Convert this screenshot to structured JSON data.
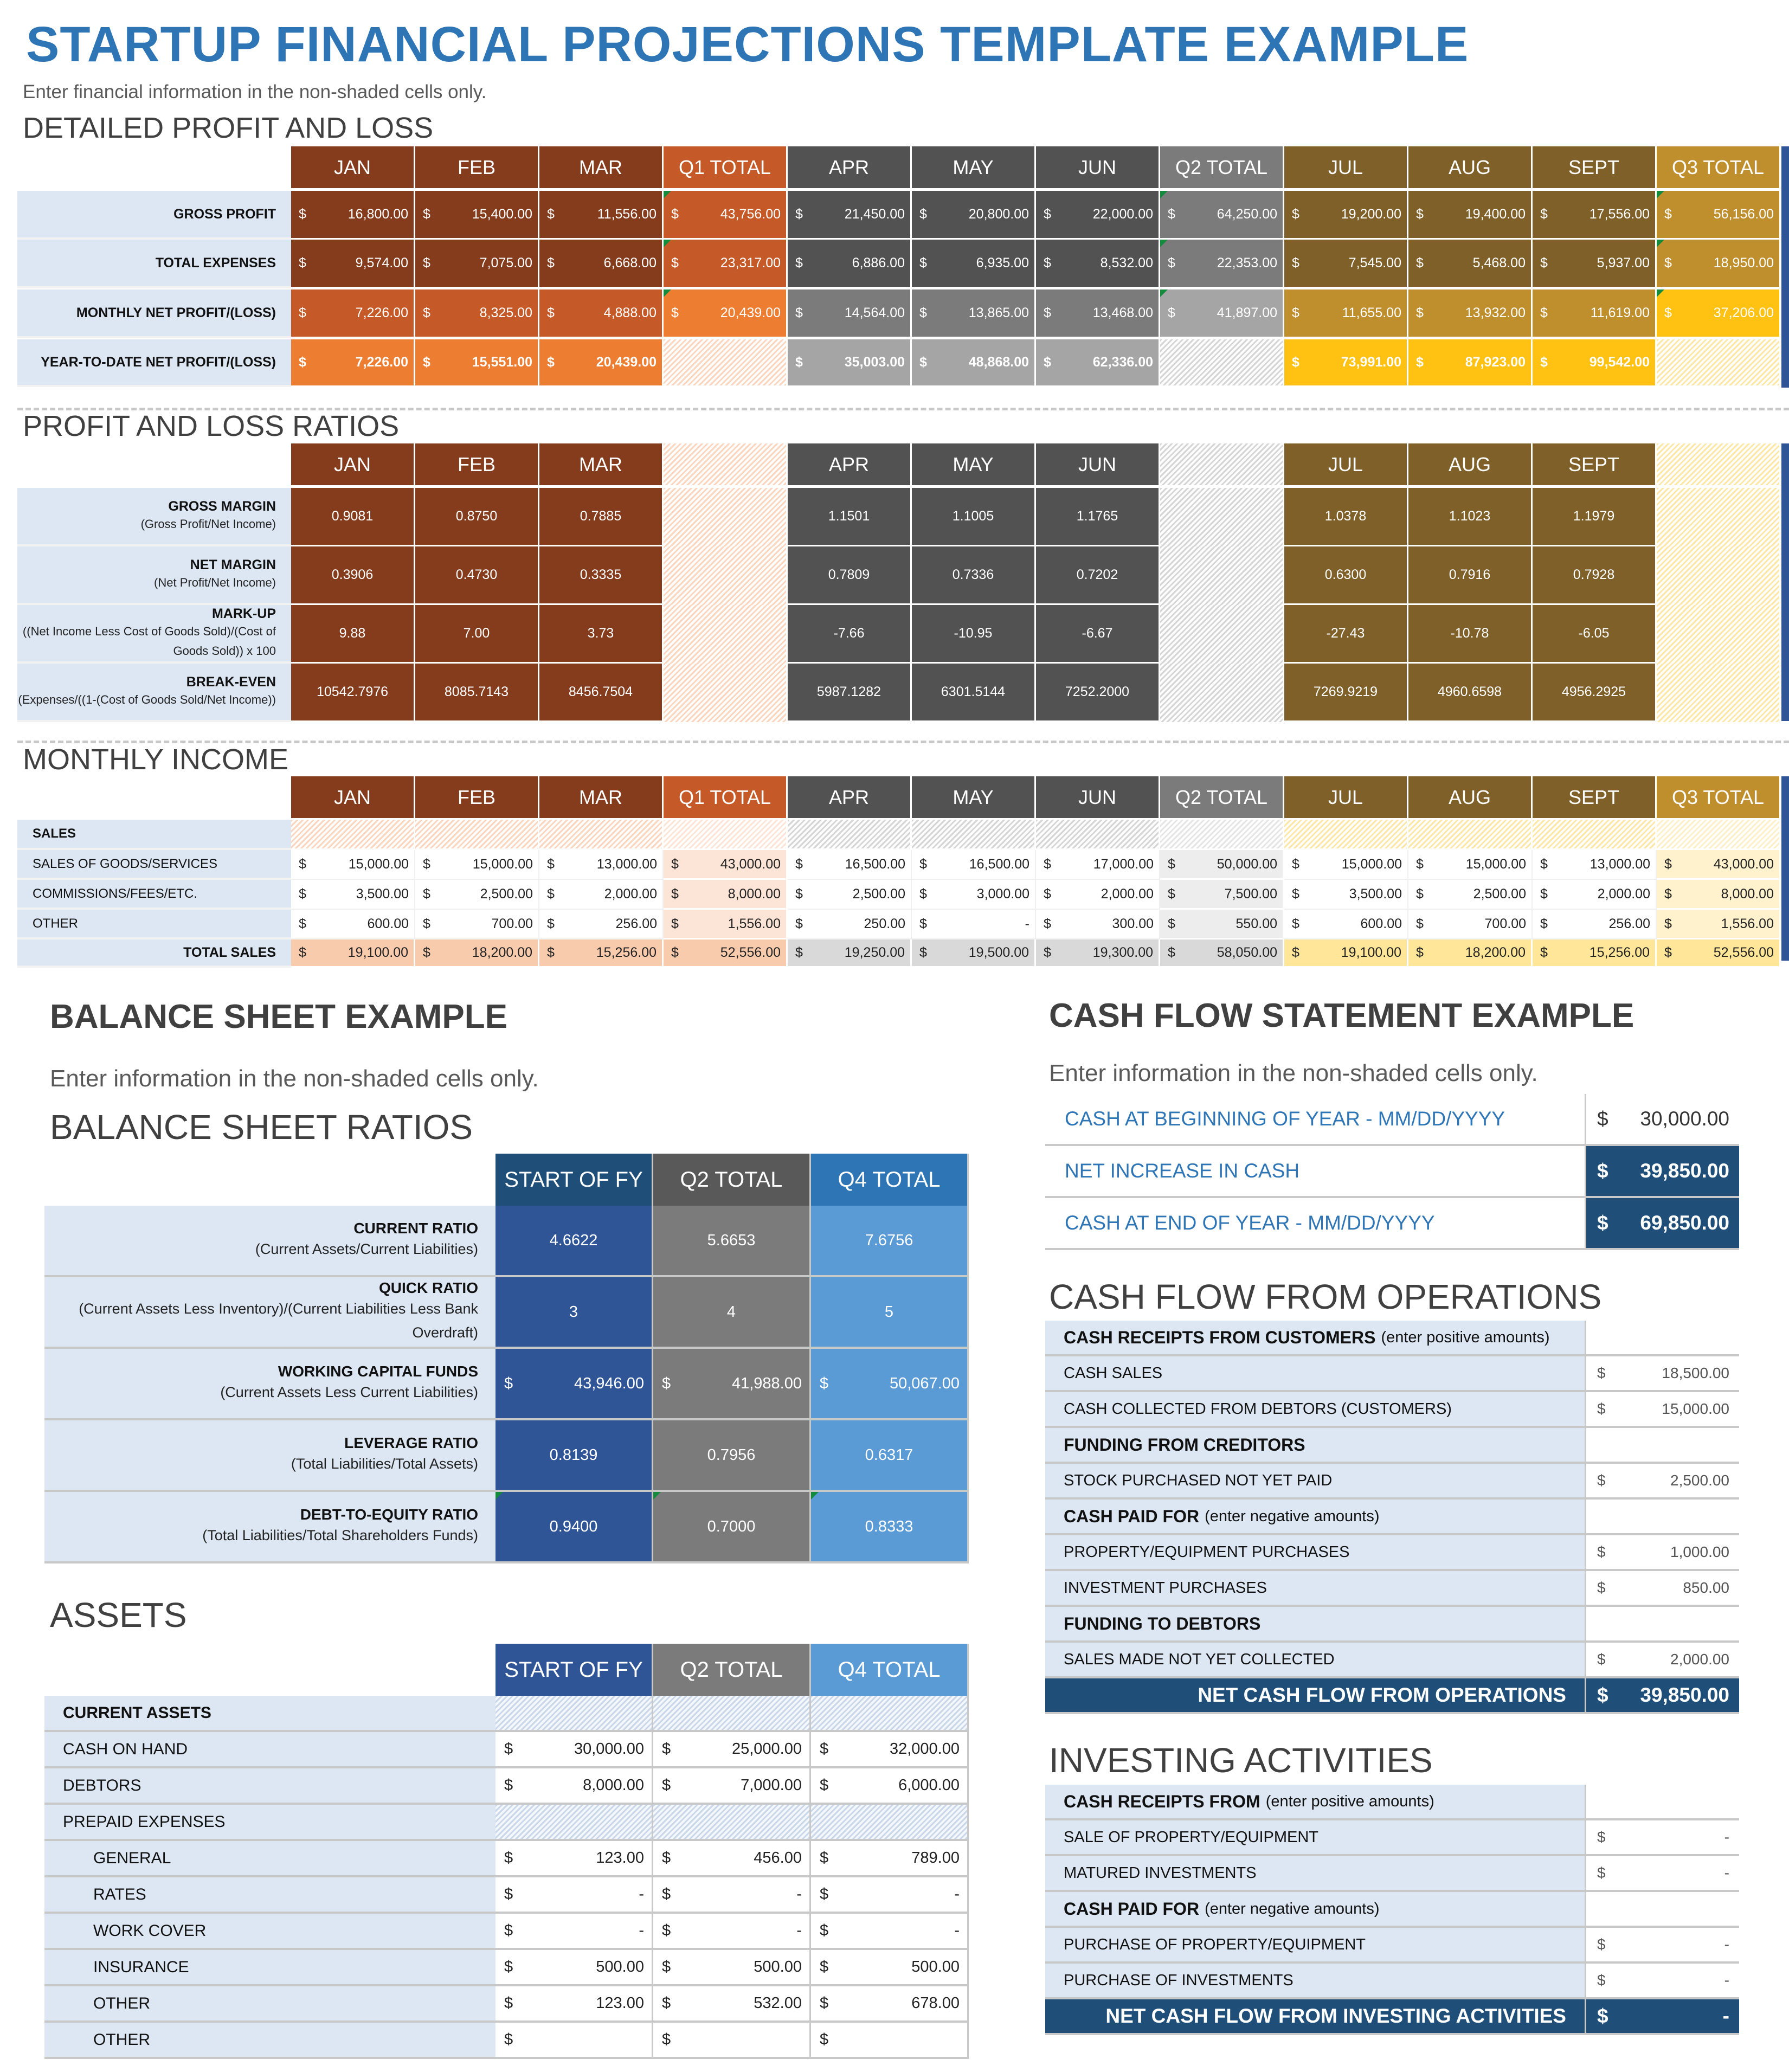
{
  "title": "STARTUP FINANCIAL PROJECTIONS TEMPLATE EXAMPLE",
  "subtitle": "Enter financial information in the non-shaded cells only.",
  "pl": {
    "heading": "DETAILED PROFIT AND LOSS",
    "columns": [
      "JAN",
      "FEB",
      "MAR",
      "Q1 TOTAL",
      "APR",
      "MAY",
      "JUN",
      "Q2 TOTAL",
      "JUL",
      "AUG",
      "SEPT",
      "Q3 TOTAL"
    ],
    "currency": "$",
    "rows": [
      {
        "label": "GROSS PROFIT",
        "values": [
          "16,800.00",
          "15,400.00",
          "11,556.00",
          "43,756.00",
          "21,450.00",
          "20,800.00",
          "22,000.00",
          "64,250.00",
          "19,200.00",
          "19,400.00",
          "17,556.00",
          "56,156.00"
        ]
      },
      {
        "label": "TOTAL EXPENSES",
        "values": [
          "9,574.00",
          "7,075.00",
          "6,668.00",
          "23,317.00",
          "6,886.00",
          "6,935.00",
          "8,532.00",
          "22,353.00",
          "7,545.00",
          "5,468.00",
          "5,937.00",
          "18,950.00"
        ]
      },
      {
        "label": "MONTHLY NET PROFIT/(LOSS)",
        "values": [
          "7,226.00",
          "8,325.00",
          "4,888.00",
          "20,439.00",
          "14,564.00",
          "13,865.00",
          "13,468.00",
          "41,897.00",
          "11,655.00",
          "13,932.00",
          "11,619.00",
          "37,206.00"
        ]
      },
      {
        "label": "YEAR-TO-DATE NET PROFIT/(LOSS)",
        "values": [
          "7,226.00",
          "15,551.00",
          "20,439.00",
          "",
          "35,003.00",
          "48,868.00",
          "62,336.00",
          "",
          "73,991.00",
          "87,923.00",
          "99,542.00",
          ""
        ]
      }
    ]
  },
  "ratios": {
    "heading": "PROFIT AND LOSS RATIOS",
    "columns": [
      "JAN",
      "FEB",
      "MAR",
      "",
      "APR",
      "MAY",
      "JUN",
      "",
      "JUL",
      "AUG",
      "SEPT",
      ""
    ],
    "rows": [
      {
        "label": "GROSS MARGIN",
        "sub": "(Gross Profit/Net Income)",
        "values": [
          "0.9081",
          "0.8750",
          "0.7885",
          "",
          "1.1501",
          "1.1005",
          "1.1765",
          "",
          "1.0378",
          "1.1023",
          "1.1979",
          ""
        ]
      },
      {
        "label": "NET MARGIN",
        "sub": "(Net Profit/Net Income)",
        "values": [
          "0.3906",
          "0.4730",
          "0.3335",
          "",
          "0.7809",
          "0.7336",
          "0.7202",
          "",
          "0.6300",
          "0.7916",
          "0.7928",
          ""
        ]
      },
      {
        "label": "MARK-UP",
        "sub": "((Net Income Less Cost of Goods Sold)/(Cost of Goods Sold)) x 100",
        "values": [
          "9.88",
          "7.00",
          "3.73",
          "",
          "-7.66",
          "-10.95",
          "-6.67",
          "",
          "-27.43",
          "-10.78",
          "-6.05",
          ""
        ]
      },
      {
        "label": "BREAK-EVEN",
        "sub": "(Expenses/((1-(Cost of Goods Sold/Net Income))",
        "values": [
          "10542.7976",
          "8085.7143",
          "8456.7504",
          "",
          "5987.1282",
          "6301.5144",
          "7252.2000",
          "",
          "7269.9219",
          "4960.6598",
          "4956.2925",
          ""
        ]
      }
    ]
  },
  "income": {
    "heading": "MONTHLY INCOME",
    "columns": [
      "JAN",
      "FEB",
      "MAR",
      "Q1 TOTAL",
      "APR",
      "MAY",
      "JUN",
      "Q2 TOTAL",
      "JUL",
      "AUG",
      "SEPT",
      "Q3 TOTAL"
    ],
    "section_label": "SALES",
    "rows": [
      {
        "label": "SALES OF GOODS/SERVICES",
        "values": [
          "15,000.00",
          "15,000.00",
          "13,000.00",
          "43,000.00",
          "16,500.00",
          "16,500.00",
          "17,000.00",
          "50,000.00",
          "15,000.00",
          "15,000.00",
          "13,000.00",
          "43,000.00"
        ]
      },
      {
        "label": "COMMISSIONS/FEES/ETC.",
        "values": [
          "3,500.00",
          "2,500.00",
          "2,000.00",
          "8,000.00",
          "2,500.00",
          "3,000.00",
          "2,000.00",
          "7,500.00",
          "3,500.00",
          "2,500.00",
          "2,000.00",
          "8,000.00"
        ]
      },
      {
        "label": "OTHER",
        "values": [
          "600.00",
          "700.00",
          "256.00",
          "1,556.00",
          "250.00",
          "-",
          "300.00",
          "550.00",
          "600.00",
          "700.00",
          "256.00",
          "1,556.00"
        ]
      }
    ],
    "total": {
      "label": "TOTAL SALES",
      "values": [
        "19,100.00",
        "18,200.00",
        "15,256.00",
        "52,556.00",
        "19,250.00",
        "19,500.00",
        "19,300.00",
        "58,050.00",
        "19,100.00",
        "18,200.00",
        "15,256.00",
        "52,556.00"
      ]
    }
  },
  "balance": {
    "heading": "BALANCE SHEET EXAMPLE",
    "subtitle": "Enter information in the non-shaded cells only.",
    "ratios_heading": "BALANCE SHEET RATIOS",
    "columns": [
      "START OF FY",
      "Q2 TOTAL",
      "Q4 TOTAL"
    ],
    "ratios": [
      {
        "label": "CURRENT RATIO",
        "sub": "(Current Assets/Current Liabilities)",
        "values": [
          "4.6622",
          "5.6653",
          "7.6756"
        ],
        "money": false
      },
      {
        "label": "QUICK RATIO",
        "sub": "(Current Assets Less Inventory)/(Current Liabilities Less Bank Overdraft)",
        "values": [
          "3",
          "4",
          "5"
        ],
        "money": false
      },
      {
        "label": "WORKING CAPITAL FUNDS",
        "sub": "(Current Assets Less Current Liabilities)",
        "values": [
          "43,946.00",
          "41,988.00",
          "50,067.00"
        ],
        "money": true
      },
      {
        "label": "LEVERAGE RATIO",
        "sub": "(Total Liabilities/Total Assets)",
        "values": [
          "0.8139",
          "0.7956",
          "0.6317"
        ],
        "money": false
      },
      {
        "label": "DEBT-TO-EQUITY RATIO",
        "sub": "(Total Liabilities/Total Shareholders Funds)",
        "values": [
          "0.9400",
          "0.7000",
          "0.8333"
        ],
        "money": false
      }
    ],
    "assets_heading": "ASSETS",
    "assets": [
      {
        "label": "CURRENT ASSETS",
        "type": "section",
        "values": [
          "",
          "",
          ""
        ]
      },
      {
        "label": "CASH ON HAND",
        "type": "item",
        "values": [
          "30,000.00",
          "25,000.00",
          "32,000.00"
        ]
      },
      {
        "label": "DEBTORS",
        "type": "item",
        "values": [
          "8,000.00",
          "7,000.00",
          "6,000.00"
        ]
      },
      {
        "label": "PREPAID EXPENSES",
        "type": "group",
        "values": [
          "",
          "",
          ""
        ]
      },
      {
        "label": "GENERAL",
        "type": "sub",
        "values": [
          "123.00",
          "456.00",
          "789.00"
        ]
      },
      {
        "label": "RATES",
        "type": "sub",
        "values": [
          "-",
          "-",
          "-"
        ]
      },
      {
        "label": "WORK COVER",
        "type": "sub",
        "values": [
          "-",
          "-",
          "-"
        ]
      },
      {
        "label": "INSURANCE",
        "type": "sub",
        "values": [
          "500.00",
          "500.00",
          "500.00"
        ]
      },
      {
        "label": "OTHER",
        "type": "sub",
        "values": [
          "123.00",
          "532.00",
          "678.00"
        ]
      },
      {
        "label": "OTHER",
        "type": "sub",
        "values": [
          "",
          "",
          ""
        ]
      }
    ]
  },
  "cashflow": {
    "heading": "CASH FLOW STATEMENT EXAMPLE",
    "subtitle": "Enter information in the non-shaded cells only.",
    "summary": [
      {
        "label": "CASH AT BEGINNING OF YEAR - MM/DD/YYYY",
        "value": "30,000.00",
        "dark": false
      },
      {
        "label": "NET INCREASE IN CASH",
        "value": "39,850.00",
        "dark": true
      },
      {
        "label": "CASH AT END OF YEAR - MM/DD/YYYY",
        "value": "69,850.00",
        "dark": true
      }
    ],
    "operations_heading": "CASH FLOW FROM OPERATIONS",
    "operations": [
      {
        "label": "CASH RECEIPTS FROM CUSTOMERS",
        "note": "(enter positive amounts)",
        "type": "section",
        "value": ""
      },
      {
        "label": "CASH SALES",
        "type": "item",
        "value": "18,500.00"
      },
      {
        "label": "CASH COLLECTED FROM DEBTORS (CUSTOMERS)",
        "type": "item",
        "value": "15,000.00"
      },
      {
        "label": "FUNDING FROM CREDITORS",
        "note": "",
        "type": "section",
        "value": ""
      },
      {
        "label": "STOCK PURCHASED NOT YET PAID",
        "type": "item",
        "value": "2,500.00"
      },
      {
        "label": "CASH PAID FOR",
        "note": "(enter negative amounts)",
        "type": "section",
        "value": ""
      },
      {
        "label": "PROPERTY/EQUIPMENT PURCHASES",
        "type": "item",
        "value": "1,000.00"
      },
      {
        "label": "INVESTMENT PURCHASES",
        "type": "item",
        "value": "850.00"
      },
      {
        "label": "FUNDING TO DEBTORS",
        "note": "",
        "type": "section",
        "value": ""
      },
      {
        "label": "SALES MADE NOT YET COLLECTED",
        "type": "item",
        "value": "2,000.00"
      }
    ],
    "operations_total": {
      "label": "NET CASH FLOW FROM OPERATIONS",
      "value": "39,850.00"
    },
    "investing_heading": "INVESTING ACTIVITIES",
    "investing": [
      {
        "label": "CASH RECEIPTS FROM",
        "note": "(enter positive amounts)",
        "type": "section",
        "value": ""
      },
      {
        "label": "SALE OF PROPERTY/EQUIPMENT",
        "type": "item",
        "value": "-"
      },
      {
        "label": "MATURED INVESTMENTS",
        "type": "item",
        "value": "-"
      },
      {
        "label": "CASH PAID FOR",
        "note": "(enter negative amounts)",
        "type": "section",
        "value": ""
      },
      {
        "label": "PURCHASE OF PROPERTY/EQUIPMENT",
        "type": "item",
        "value": "-"
      },
      {
        "label": "PURCHASE OF INVESTMENTS",
        "type": "item",
        "value": "-"
      }
    ],
    "investing_total": {
      "label": "NET CASH FLOW FROM INVESTING ACTIVITIES",
      "value": "-"
    },
    "currency": "$"
  },
  "colors": {
    "title_blue": "#2E75B6",
    "q1_dark": "#843C1C",
    "q1_mid": "#C55A28",
    "q1_light": "#ED7D31",
    "q2_dark": "#525252",
    "q2_mid": "#7B7B7B",
    "q2_light": "#A5A5A5",
    "q3_dark": "#7F6029",
    "q3_mid": "#BF8F2E",
    "q3_light": "#FFC112",
    "navy": "#1F4E79",
    "label_bg": "#DCE7F3"
  }
}
